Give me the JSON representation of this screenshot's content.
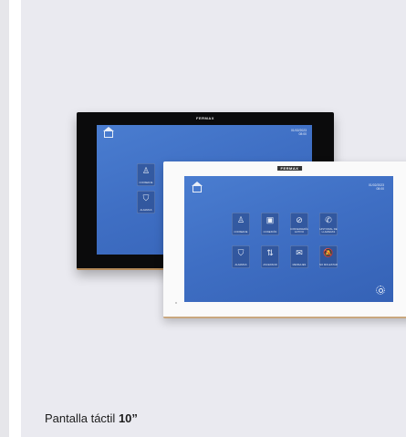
{
  "brand": "FERMAX",
  "screen": {
    "date": "01/02/2023",
    "time": "08:00"
  },
  "black_monitor": {
    "tiles": [
      {
        "icon": "concierge-icon",
        "glyph": "♙",
        "label": "CONSERJE"
      },
      {
        "icon": "shield-icon",
        "glyph": "⛉",
        "label": "ALARMAS"
      }
    ]
  },
  "white_monitor": {
    "tiles": [
      {
        "icon": "concierge-icon",
        "glyph": "♙",
        "label": "CONSERJE"
      },
      {
        "icon": "intercom-icon",
        "glyph": "▣",
        "label": "CONEXIÓN"
      },
      {
        "icon": "do-not-disturb-icon",
        "glyph": "⊘",
        "label": "CONSERJERÍA ACTIVO"
      },
      {
        "icon": "phone-icon",
        "glyph": "✆",
        "label": "HISTORIAL DE LLAMADAS"
      },
      {
        "icon": "shield-icon",
        "glyph": "⛉",
        "label": "ALARMAS"
      },
      {
        "icon": "elevator-icon",
        "glyph": "⇅",
        "label": "ASCENSOR"
      },
      {
        "icon": "mail-icon",
        "glyph": "✉",
        "label": "MENSAJES"
      },
      {
        "icon": "bell-off-icon",
        "glyph": "🔕",
        "label": "NO MOLESTAR"
      }
    ]
  },
  "caption": {
    "text": "Pantalla táctil ",
    "size": "10”"
  }
}
